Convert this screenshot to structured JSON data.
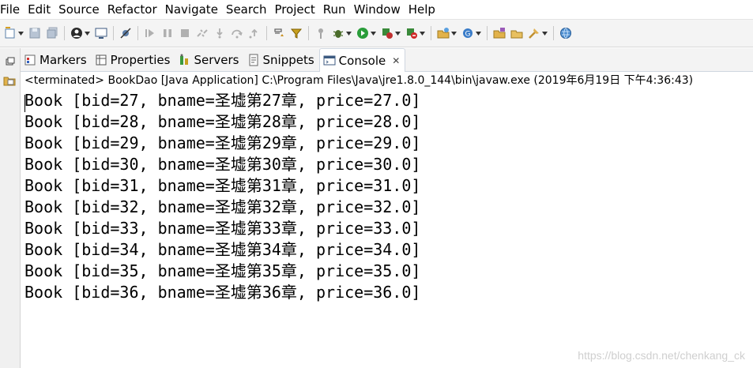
{
  "menu": [
    "File",
    "Edit",
    "Source",
    "Refactor",
    "Navigate",
    "Search",
    "Project",
    "Run",
    "Window",
    "Help"
  ],
  "toolbar_icons": [
    "new-icon",
    "save-icon",
    "save-all-icon",
    "user-icon",
    "terminal-icon",
    "skip-breakpoints-icon",
    "resume-icon",
    "suspend-icon",
    "terminate-icon",
    "disconnect-icon",
    "step-into-icon",
    "step-over-icon",
    "step-return-icon",
    "drop-to-frame-icon",
    "use-step-filters-icon",
    "pin-icon",
    "debug-icon",
    "run-icon",
    "coverage-icon",
    "external-tools-icon",
    "new-java-project-icon",
    "new-package-icon",
    "new-class-icon",
    "open-type-icon",
    "open-task-icon",
    "search-icon",
    "globe-icon"
  ],
  "tabs": [
    {
      "label": "Markers",
      "icon": "markers-icon"
    },
    {
      "label": "Properties",
      "icon": "properties-icon"
    },
    {
      "label": "Servers",
      "icon": "servers-icon"
    },
    {
      "label": "Snippets",
      "icon": "snippets-icon"
    },
    {
      "label": "Console",
      "icon": "console-icon",
      "close": "✕"
    }
  ],
  "status": "<terminated> BookDao [Java Application] C:\\Program Files\\Java\\jre1.8.0_144\\bin\\javaw.exe (2019年6月19日 下午4:36:43)",
  "console_lines": [
    "Book [bid=27, bname=圣墟第27章, price=27.0]",
    "Book [bid=28, bname=圣墟第28章, price=28.0]",
    "Book [bid=29, bname=圣墟第29章, price=29.0]",
    "Book [bid=30, bname=圣墟第30章, price=30.0]",
    "Book [bid=31, bname=圣墟第31章, price=31.0]",
    "Book [bid=32, bname=圣墟第32章, price=32.0]",
    "Book [bid=33, bname=圣墟第33章, price=33.0]",
    "Book [bid=34, bname=圣墟第34章, price=34.0]",
    "Book [bid=35, bname=圣墟第35章, price=35.0]",
    "Book [bid=36, bname=圣墟第36章, price=36.0]"
  ],
  "watermark": "https://blog.csdn.net/chenkang_ck"
}
